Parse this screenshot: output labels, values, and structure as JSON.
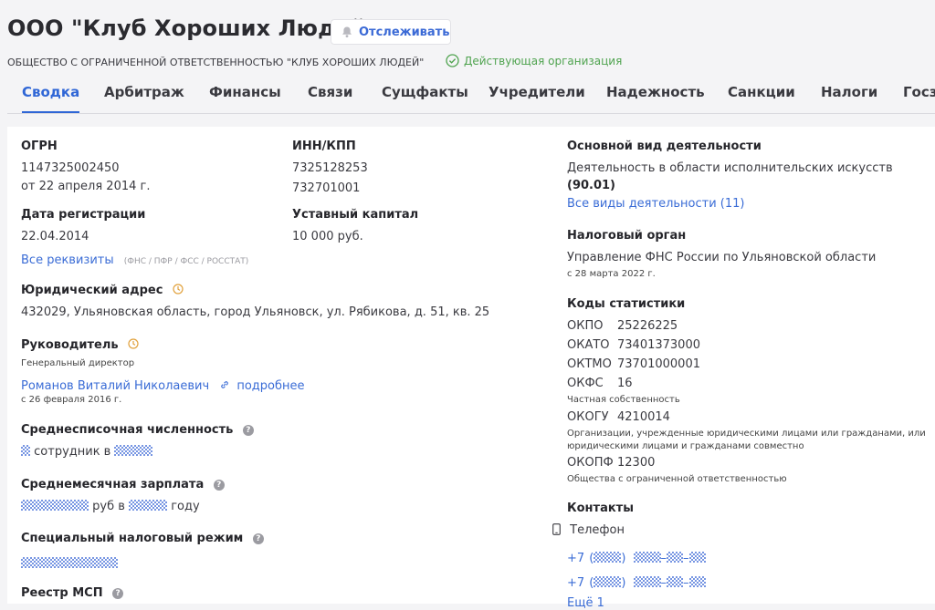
{
  "header": {
    "title": "ООО \"Клуб Хороших Людей\"",
    "track_label": "Отслеживать",
    "full_name": "ОБЩЕСТВО С ОГРАНИЧЕННОЙ ОТВЕТСТВЕННОСТЬЮ \"КЛУБ ХОРОШИХ ЛЮДЕЙ\"",
    "status": "Действующая организация",
    "status_color": "#4fa34f",
    "accent_color": "#2f66d6"
  },
  "tabs": [
    "Сводка",
    "Арбитраж",
    "Финансы",
    "Связи",
    "Сущфакты",
    "Учредители",
    "Надежность",
    "Санкции",
    "Налоги",
    "Госз"
  ],
  "ogrn": {
    "label": "ОГРН",
    "value": "1147325002450",
    "date": "от 22 апреля 2014 г."
  },
  "inn": {
    "label": "ИНН/КПП",
    "inn": "7325128253",
    "kpp": "732701001"
  },
  "reg": {
    "label": "Дата регистрации",
    "value": "22.04.2014"
  },
  "capital": {
    "label": "Уставный капитал",
    "value": "10 000 руб."
  },
  "requisites": {
    "link": "Все реквизиты",
    "note": "(ФНС / ПФР / ФСС / РОССТАТ)"
  },
  "address": {
    "label": "Юридический адрес",
    "value": "432029, Ульяновская область, город Ульяновск, ул. Рябикова, д. 51, кв. 25"
  },
  "head": {
    "label": "Руководитель",
    "role": "Генеральный директор",
    "name": "Романов Виталий Николаевич",
    "more": "подробнее",
    "since": "с 26 февраля 2016 г."
  },
  "staff": {
    "label": "Среднесписочная численность",
    "mid": "сотрудник в"
  },
  "salary": {
    "label": "Среднемесячная зарплата",
    "mid": "руб в",
    "end": "году"
  },
  "tax_regime": {
    "label": "Специальный налоговый режим"
  },
  "msp": {
    "label": "Реестр МСП"
  },
  "activity": {
    "label": "Основной вид деятельности",
    "value": "Деятельность в области исполнительских искусств",
    "code": "(90.01)",
    "all": "Все виды деятельности (11)"
  },
  "tax_office": {
    "label": "Налоговый орган",
    "value": "Управление ФНС России по Ульяновской области",
    "since": "с 28 марта 2022 г."
  },
  "stats": {
    "label": "Коды статистики",
    "okpo": {
      "k": "ОКПО",
      "v": "25226225"
    },
    "okato": {
      "k": "ОКАТО",
      "v": "73401373000"
    },
    "oktmo": {
      "k": "ОКТМО",
      "v": "73701000001"
    },
    "okfs": {
      "k": "ОКФС",
      "v": "16",
      "desc": "Частная собственность"
    },
    "okogu": {
      "k": "ОКОГУ",
      "v": "4210014",
      "desc1": "Организации, учрежденные юридическими лицами или гражданами, или",
      "desc2": "юридическими лицами и гражданами совместно"
    },
    "okopf": {
      "k": "ОКОПФ",
      "v": "12300",
      "desc": "Общества с ограниченной ответственностью"
    }
  },
  "contacts": {
    "label": "Контакты",
    "phone_label": "Телефон",
    "phone_prefix": "+7",
    "more": "Ещё 1"
  }
}
